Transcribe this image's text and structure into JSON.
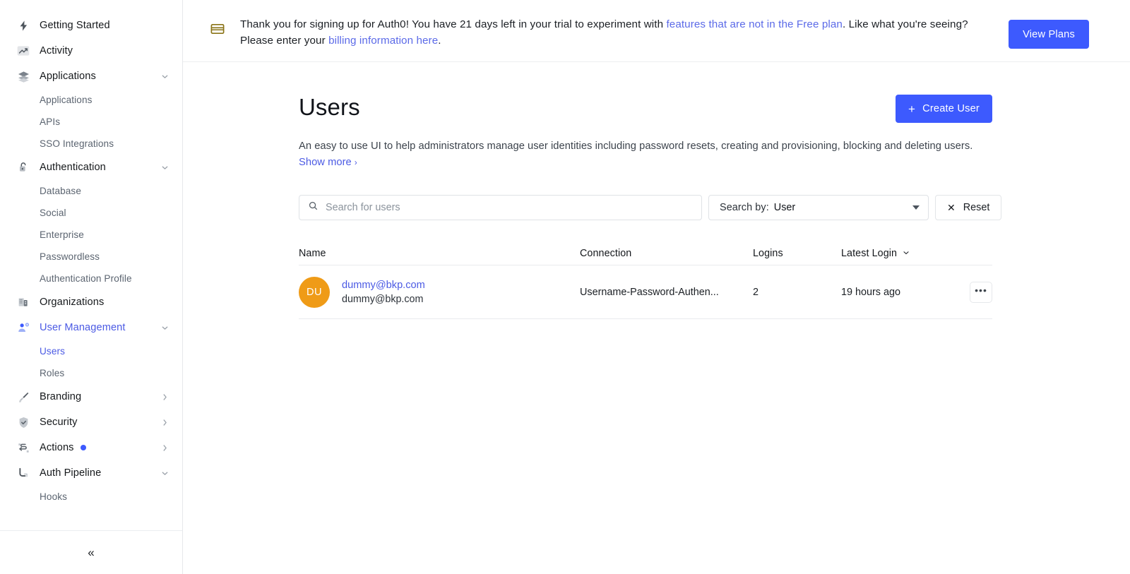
{
  "sidebar": {
    "items": [
      {
        "label": "Getting Started",
        "icon": "bolt-icon",
        "type": "item"
      },
      {
        "label": "Activity",
        "icon": "activity-chart-icon",
        "type": "item"
      },
      {
        "label": "Applications",
        "icon": "layers-icon",
        "type": "item",
        "expander": "chevron-down-icon"
      },
      {
        "label": "Applications",
        "type": "sub"
      },
      {
        "label": "APIs",
        "type": "sub"
      },
      {
        "label": "SSO Integrations",
        "type": "sub"
      },
      {
        "label": "Authentication",
        "icon": "lock-icon",
        "type": "item",
        "expander": "chevron-down-icon"
      },
      {
        "label": "Database",
        "type": "sub"
      },
      {
        "label": "Social",
        "type": "sub"
      },
      {
        "label": "Enterprise",
        "type": "sub"
      },
      {
        "label": "Passwordless",
        "type": "sub"
      },
      {
        "label": "Authentication Profile",
        "type": "sub"
      },
      {
        "label": "Organizations",
        "icon": "building-icon",
        "type": "item"
      },
      {
        "label": "User Management",
        "icon": "user-gear-icon",
        "type": "item",
        "expander": "chevron-down-icon",
        "active": true
      },
      {
        "label": "Users",
        "type": "sub",
        "active": true
      },
      {
        "label": "Roles",
        "type": "sub"
      },
      {
        "label": "Branding",
        "icon": "brush-icon",
        "type": "item",
        "expander": "chevron-right-icon"
      },
      {
        "label": "Security",
        "icon": "shield-check-icon",
        "type": "item",
        "expander": "chevron-right-icon"
      },
      {
        "label": "Actions",
        "icon": "actions-flow-icon",
        "type": "item",
        "expander": "chevron-right-icon",
        "badge": true
      },
      {
        "label": "Auth Pipeline",
        "icon": "pipeline-icon",
        "type": "item",
        "expander": "chevron-down-icon"
      },
      {
        "label": "Hooks",
        "type": "sub"
      }
    ],
    "collapse_glyph": "«",
    "collapse_name": "collapse-sidebar-button"
  },
  "banner": {
    "icon": "credit-card-icon",
    "text_part1": "Thank you for signing up for Auth0! You have 21 days left in your trial to experiment with ",
    "link1": "features that are not in the Free plan",
    "text_part2": ". Like what you're seeing? Please enter your ",
    "link2": "billing information here",
    "text_part3": ".",
    "button_label": "View Plans"
  },
  "page": {
    "title": "Users",
    "create_button_label": "Create User",
    "create_button_plus": "+",
    "description": "An easy to use UI to help administrators manage user identities including password resets, creating and provisioning, blocking and deleting users. ",
    "show_more_label": "Show more",
    "show_more_chevron": "›"
  },
  "filters": {
    "search_placeholder": "Search for users",
    "search_value": "",
    "search_icon": "search-icon",
    "search_by_label": "Search by:",
    "search_by_value": "User",
    "reset_label": "Reset",
    "reset_icon": "✕"
  },
  "table": {
    "columns": [
      "Name",
      "Connection",
      "Logins",
      "Latest Login"
    ],
    "sort_column": "Latest Login",
    "sort_chevron": "⌄",
    "rows": [
      {
        "initials": "DU",
        "name": "dummy@bkp.com",
        "email": "dummy@bkp.com",
        "connection": "Username-Password-Authen...",
        "logins": "2",
        "latest_login": "19 hours ago",
        "more_glyph": "•••"
      }
    ]
  },
  "colors": {
    "accent_blue": "#3d5afe",
    "link_blue": "#4b5ae4",
    "avatar_orange": "#ef9b17",
    "banner_icon": "#8a7316"
  }
}
